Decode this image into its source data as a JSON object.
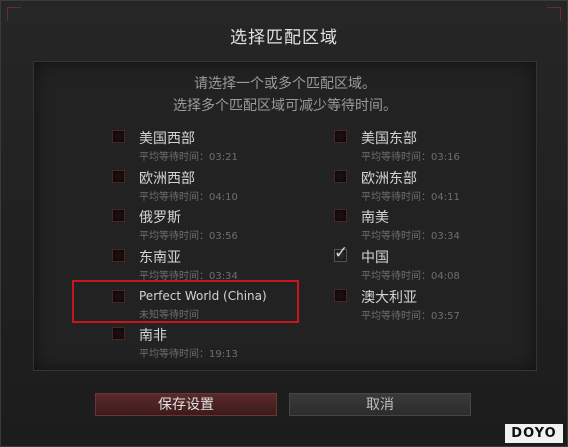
{
  "dialog": {
    "title": "选择匹配区域",
    "instruction_line1": "请选择一个或多个匹配区域。",
    "instruction_line2": "选择多个匹配区域可减少等待时间。"
  },
  "regions": [
    {
      "name": "美国西部",
      "wait": "平均等待时间：03:21",
      "checked": false
    },
    {
      "name": "美国东部",
      "wait": "平均等待时间：03:16",
      "checked": false
    },
    {
      "name": "欧洲西部",
      "wait": "平均等待时间：04:10",
      "checked": false
    },
    {
      "name": "欧洲东部",
      "wait": "平均等待时间：04:11",
      "checked": false
    },
    {
      "name": "俄罗斯",
      "wait": "平均等待时间：03:56",
      "checked": false
    },
    {
      "name": "南美",
      "wait": "平均等待时间：03:34",
      "checked": false
    },
    {
      "name": "东南亚",
      "wait": "平均等待时间：03:34",
      "checked": false
    },
    {
      "name": "中国",
      "wait": "平均等待时间：04:08",
      "checked": true
    },
    {
      "name": "Perfect World (China)",
      "wait": "未知等待时间",
      "checked": false
    },
    {
      "name": "澳大利亚",
      "wait": "平均等待时间：03:57",
      "checked": false
    },
    {
      "name": "南非",
      "wait": "平均等待时间：19:13",
      "checked": false
    }
  ],
  "buttons": {
    "save_label": "保存设置",
    "cancel_label": "取消"
  },
  "watermark": "DOYO",
  "colors": {
    "highlight": "#c8161b",
    "save_button": "#4a2222",
    "checkbox_border": "#4e2424"
  }
}
